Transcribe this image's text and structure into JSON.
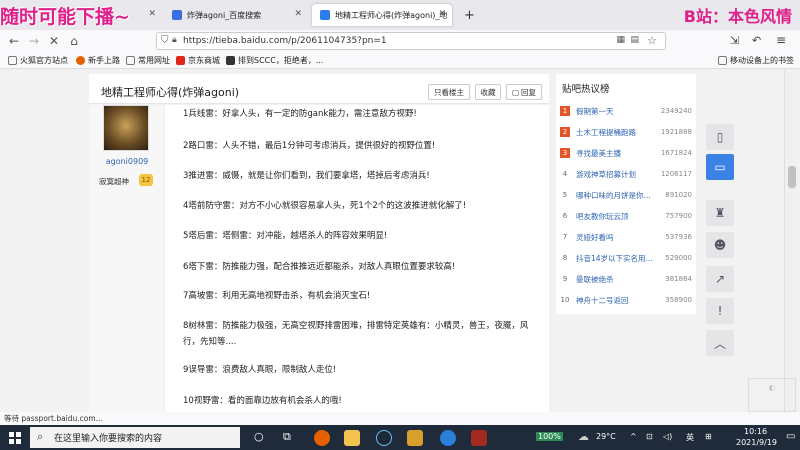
{
  "overlay": {
    "left_text": "随时可能下播~",
    "right_text": "B站：本色风情"
  },
  "tabs": [
    {
      "label": ""
    },
    {
      "label": "炸弹agoni_百度搜索"
    },
    {
      "label": "地精工程师心得(炸弹agoni)_地"
    }
  ],
  "url": "https://tieba.baidu.com/p/2061104735?pn=1",
  "bookmarks": [
    "火狐官方站点",
    "新手上路",
    "常用网址",
    "京东商城",
    "排到SCCC，拒绝者，...",
    "移动设备上的书签"
  ],
  "post": {
    "title": "地精工程师心得(炸弹agoni)",
    "buttons": {
      "only_author": "只看楼主",
      "favorite": "收藏",
      "reply": "回复"
    },
    "author": {
      "name": "agoni0909",
      "rank": "寂寞超神",
      "level": "12"
    },
    "lines": [
      "1兵线雷：好拿人头，有一定的防gank能力，需注意敌方视野!",
      "2路口雷：人头不错，最后1分钟可考虑消兵，提供很好的视野位置!",
      "3推进雷：威慑，就是让你们看到，我们要拿塔，塔掉后考虑消兵!",
      "4塔前防守雷：对方不小心就很容易拿人头，死1个2个的这波推进就化解了!",
      "5塔后雷：塔侧雷：对冲能，越塔杀人的阵容效果明显!",
      "6塔下雷：防推能力强，配合推推远近都能杀，对敌人真眼位置要求较高!",
      "7高坡雷：利用无高地视野击杀，有机会消灭宝石!",
      "8树林雷：防推能力极强，无高空视野排雷困难，排雷特定英雄有：小精灵，兽王，夜魇，风行，先知等....",
      "9误导雷：浪费敌人真眼，限制敌人走位!",
      "10视野雷：看的面靠边放有机会杀人的哦!"
    ]
  },
  "sidebar": {
    "title": "贴吧热议榜",
    "items": [
      {
        "rank": "1",
        "name": "假期第一天",
        "count": "2349240"
      },
      {
        "rank": "2",
        "name": "土木工程提桶跑路",
        "count": "1921888"
      },
      {
        "rank": "3",
        "name": "寻找最美主播",
        "count": "1671824"
      },
      {
        "rank": "4",
        "name": "游戏神草招募计划",
        "count": "1206117"
      },
      {
        "rank": "5",
        "name": "哪种口味的月饼是你...",
        "count": "891020"
      },
      {
        "rank": "6",
        "name": "吧友教你玩云顶",
        "count": "757900"
      },
      {
        "rank": "7",
        "name": "灵娅好看吗",
        "count": "537936"
      },
      {
        "rank": "8",
        "name": "抖音14岁以下实名用...",
        "count": "529000"
      },
      {
        "rank": "9",
        "name": "曼联被绝杀",
        "count": "381864"
      },
      {
        "rank": "10",
        "name": "神舟十二号返回",
        "count": "358900"
      }
    ]
  },
  "status": "等待 passport.baidu.com...",
  "taskbar": {
    "search_placeholder": "在这里输入你要搜索的内容",
    "battery": "100%",
    "temp": "29°C",
    "lang": "英",
    "time": "10:16",
    "date": "2021/9/19"
  },
  "colors": {
    "overlay": "#e0208a",
    "accent": "#e25526",
    "link": "#2d64b3"
  }
}
